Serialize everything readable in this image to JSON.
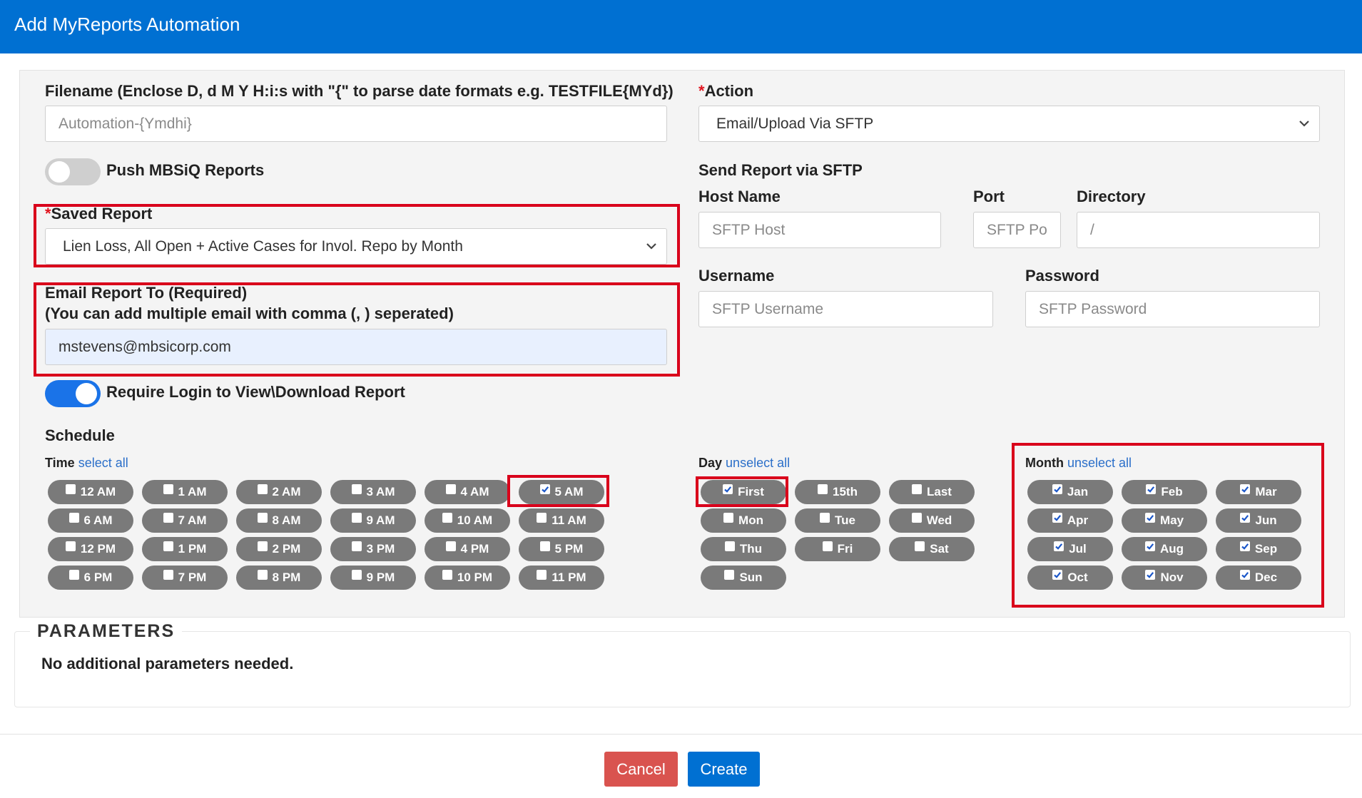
{
  "header": {
    "title": "Add MyReports Automation"
  },
  "filename": {
    "label": "Filename (Enclose D, d M Y H:i:s with \"{\" to parse date formats e.g. TESTFILE{MYd})",
    "placeholder": "Automation-{Ymdhi}"
  },
  "push_mbsiq": {
    "label": "Push MBSiQ Reports",
    "enabled": false
  },
  "saved_report": {
    "required_mark": "*",
    "label": "Saved Report",
    "value": "Lien Loss, All Open + Active Cases for Invol. Repo by Month"
  },
  "email": {
    "label_line1": "Email Report To (Required)",
    "label_line2": "(You can add multiple email with comma (, ) seperated)",
    "value": "mstevens@mbsicorp.com"
  },
  "require_login": {
    "label": "Require Login to View\\Download Report",
    "enabled": true
  },
  "action": {
    "required_mark": "*",
    "label": "Action",
    "value": "Email/Upload Via SFTP"
  },
  "sftp": {
    "section_title": "Send Report via SFTP",
    "host_label": "Host Name",
    "host_placeholder": "SFTP Host",
    "port_label": "Port",
    "port_placeholder": "SFTP Port",
    "directory_label": "Directory",
    "directory_placeholder": "/",
    "username_label": "Username",
    "username_placeholder": "SFTP Username",
    "password_label": "Password",
    "password_placeholder": "SFTP Password"
  },
  "schedule": {
    "title": "Schedule",
    "time": {
      "label": "Time",
      "link": "select all",
      "options": [
        {
          "label": "12 AM",
          "checked": false
        },
        {
          "label": "1 AM",
          "checked": false
        },
        {
          "label": "2 AM",
          "checked": false
        },
        {
          "label": "3 AM",
          "checked": false
        },
        {
          "label": "4 AM",
          "checked": false
        },
        {
          "label": "5 AM",
          "checked": true
        },
        {
          "label": "6 AM",
          "checked": false
        },
        {
          "label": "7 AM",
          "checked": false
        },
        {
          "label": "8 AM",
          "checked": false
        },
        {
          "label": "9 AM",
          "checked": false
        },
        {
          "label": "10 AM",
          "checked": false
        },
        {
          "label": "11 AM",
          "checked": false
        },
        {
          "label": "12 PM",
          "checked": false
        },
        {
          "label": "1 PM",
          "checked": false
        },
        {
          "label": "2 PM",
          "checked": false
        },
        {
          "label": "3 PM",
          "checked": false
        },
        {
          "label": "4 PM",
          "checked": false
        },
        {
          "label": "5 PM",
          "checked": false
        },
        {
          "label": "6 PM",
          "checked": false
        },
        {
          "label": "7 PM",
          "checked": false
        },
        {
          "label": "8 PM",
          "checked": false
        },
        {
          "label": "9 PM",
          "checked": false
        },
        {
          "label": "10 PM",
          "checked": false
        },
        {
          "label": "11 PM",
          "checked": false
        }
      ]
    },
    "day": {
      "label": "Day",
      "link": "unselect all",
      "options": [
        {
          "label": "First",
          "checked": true
        },
        {
          "label": "15th",
          "checked": false
        },
        {
          "label": "Last",
          "checked": false
        },
        {
          "label": "Mon",
          "checked": false
        },
        {
          "label": "Tue",
          "checked": false
        },
        {
          "label": "Wed",
          "checked": false
        },
        {
          "label": "Thu",
          "checked": false
        },
        {
          "label": "Fri",
          "checked": false
        },
        {
          "label": "Sat",
          "checked": false
        },
        {
          "label": "Sun",
          "checked": false
        }
      ]
    },
    "month": {
      "label": "Month",
      "link": "unselect all",
      "options": [
        {
          "label": "Jan",
          "checked": true
        },
        {
          "label": "Feb",
          "checked": true
        },
        {
          "label": "Mar",
          "checked": true
        },
        {
          "label": "Apr",
          "checked": true
        },
        {
          "label": "May",
          "checked": true
        },
        {
          "label": "Jun",
          "checked": true
        },
        {
          "label": "Jul",
          "checked": true
        },
        {
          "label": "Aug",
          "checked": true
        },
        {
          "label": "Sep",
          "checked": true
        },
        {
          "label": "Oct",
          "checked": true
        },
        {
          "label": "Nov",
          "checked": true
        },
        {
          "label": "Dec",
          "checked": true
        }
      ]
    }
  },
  "parameters": {
    "title": "PARAMETERS",
    "message": "No additional parameters needed."
  },
  "footer": {
    "cancel_label": "Cancel",
    "create_label": "Create"
  },
  "colors": {
    "header": "#0070d2",
    "pill": "#7a7a7a",
    "highlight": "#d9001b",
    "cancel": "#d9534f",
    "toggle_on": "#1a73e8"
  }
}
